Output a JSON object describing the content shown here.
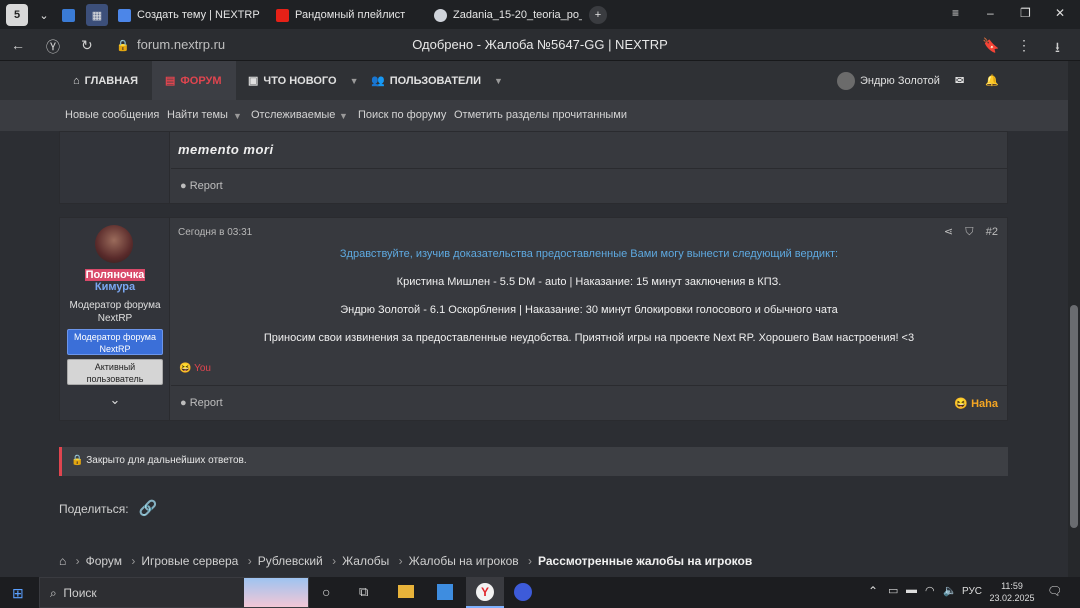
{
  "browser": {
    "tabs": [
      {
        "label": "",
        "icon": "app-icon"
      },
      {
        "label": "Создать тему | NEXTRP",
        "icon": "nextrp-icon"
      },
      {
        "label": "Рандомный плейлист",
        "icon": "youtube-icon"
      },
      {
        "label": "Zadania_15-20_teoria_po_",
        "icon": "wordpress-icon"
      }
    ],
    "tab_count": "5",
    "url": "forum.nextrp.ru",
    "page_title": "Одобрено - Жалоба №5647-GG | NEXTRP"
  },
  "nav": {
    "home": "ГЛАВНАЯ",
    "forum": "ФОРУМ",
    "whats_new": "ЧТО НОВОГО",
    "users": "ПОЛЬЗОВАТЕЛИ",
    "username": "Эндрю Золотой",
    "sub": [
      "Новые сообщения",
      "Найти темы",
      "Отслеживаемые",
      "Поиск по форуму",
      "Отметить разделы прочитанными"
    ]
  },
  "prev_post": {
    "signature": "memento mori",
    "report": "Report"
  },
  "post": {
    "username_line1": "Поляночка",
    "username_line2": "Кимура",
    "user_title": "Модератор форума NextRP",
    "badge1": "Модератор форума NextRP",
    "badge2": "Активный пользователь",
    "date": "Сегодня в 03:31",
    "number": "#2",
    "lines": [
      "Здравствуйте, изучив доказательства предоставленные Вами могу вынести следующий вердикт:",
      "Кристина Мишлен - 5.5 DM - auto | Наказание: 15 минут заключения в КПЗ.",
      "Эндрю Золотой - 6.1 Оскорбления | Наказание: 30 минут блокировки голосового и обычного чата",
      "Приносим свои извинения за предоставленные неудобства. Приятной игры на проекте Next RP. Хорошего Вам настроения! <3"
    ],
    "reaction_you": "You",
    "report": "Report",
    "haha": "Haha"
  },
  "closed": "Закрыто для дальнейших ответов.",
  "share": "Поделиться:",
  "breadcrumb": [
    "Форум",
    "Игровые сервера",
    "Рублевский",
    "Жалобы",
    "Жалобы на игроков",
    "Рассмотренные жалобы на игроков"
  ],
  "taskbar": {
    "search": "Поиск",
    "lang": "РУС",
    "time": "11:59",
    "date": "23.02.2025"
  },
  "colors": {
    "accent_red": "#e0454f",
    "link_blue": "#5ea9e0",
    "badge_blue": "#3b6fd8",
    "reaction": "#f5a623"
  }
}
